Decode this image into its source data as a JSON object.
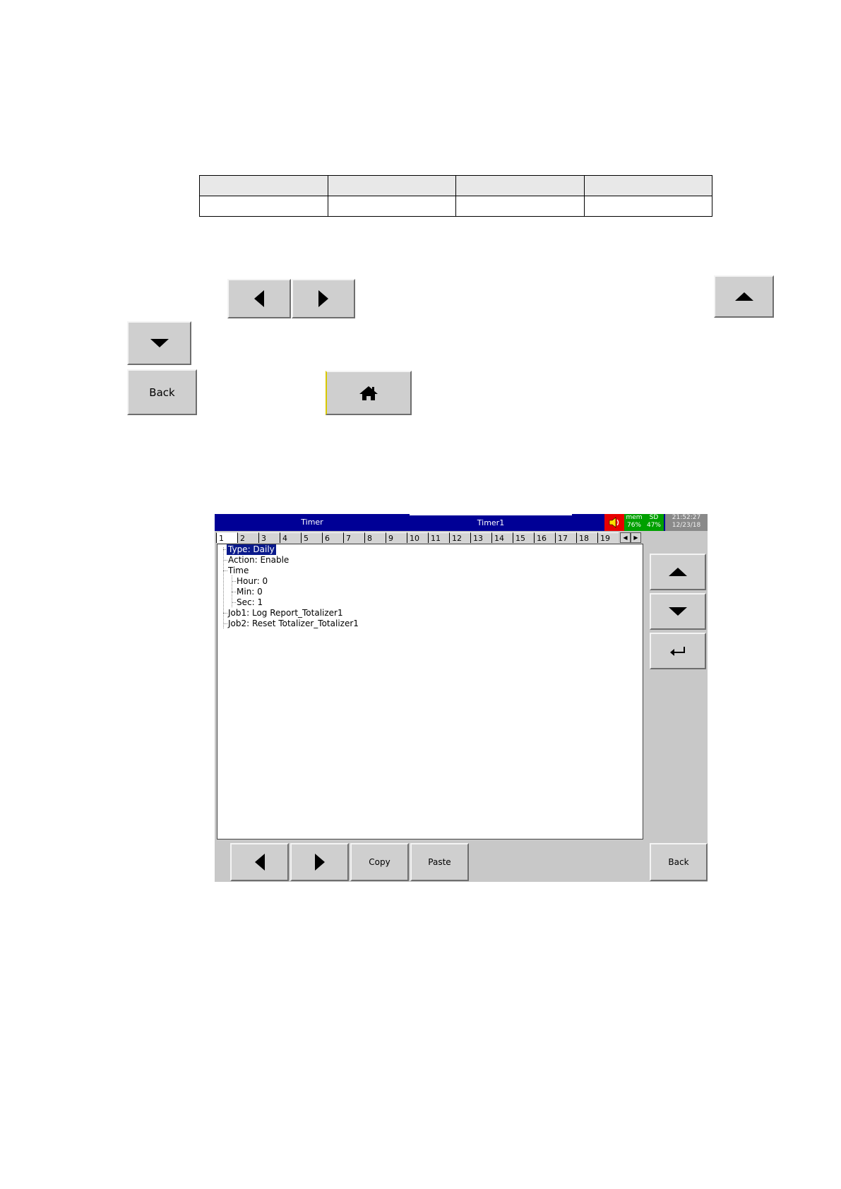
{
  "doc_table": {
    "rows": [
      [
        "",
        "",
        "",
        ""
      ],
      [
        "",
        "",
        "",
        ""
      ]
    ]
  },
  "doc_buttons": {
    "back_label": "Back"
  },
  "icons": {
    "left": "left-arrow-icon",
    "right": "right-arrow-icon",
    "up": "up-arrow-icon",
    "down": "down-arrow-icon",
    "home": "home-icon",
    "enter": "enter-icon",
    "speaker": "speaker-icon"
  },
  "screen": {
    "title_left": "Timer",
    "title_right": "Timer1",
    "mem_label": "mem",
    "mem_value": "76%",
    "sd_label": "SD",
    "sd_value": "47%",
    "time": "21:52:27",
    "date": "12/23/18",
    "tabs": [
      "1",
      "2",
      "3",
      "4",
      "5",
      "6",
      "7",
      "8",
      "9",
      "10",
      "11",
      "12",
      "13",
      "14",
      "15",
      "16",
      "17",
      "18",
      "19"
    ],
    "active_tab": "1",
    "tree": {
      "type": "Type: Daily",
      "action": "Action: Enable",
      "time": "Time",
      "hour": "Hour: 0",
      "min": "Min: 0",
      "sec": "Sec: 1",
      "job1": "Job1: Log Report_Totalizer1",
      "job2": "Job2: Reset Totalizer_Totalizer1"
    },
    "copy_label": "Copy",
    "paste_label": "Paste",
    "back_label": "Back"
  },
  "colors": {
    "title_bar": "#000096",
    "speaker_bg": "#e80000",
    "status_green": "#00a000",
    "selection": "#0a1a8c",
    "button_face": "#cfcfcf"
  }
}
